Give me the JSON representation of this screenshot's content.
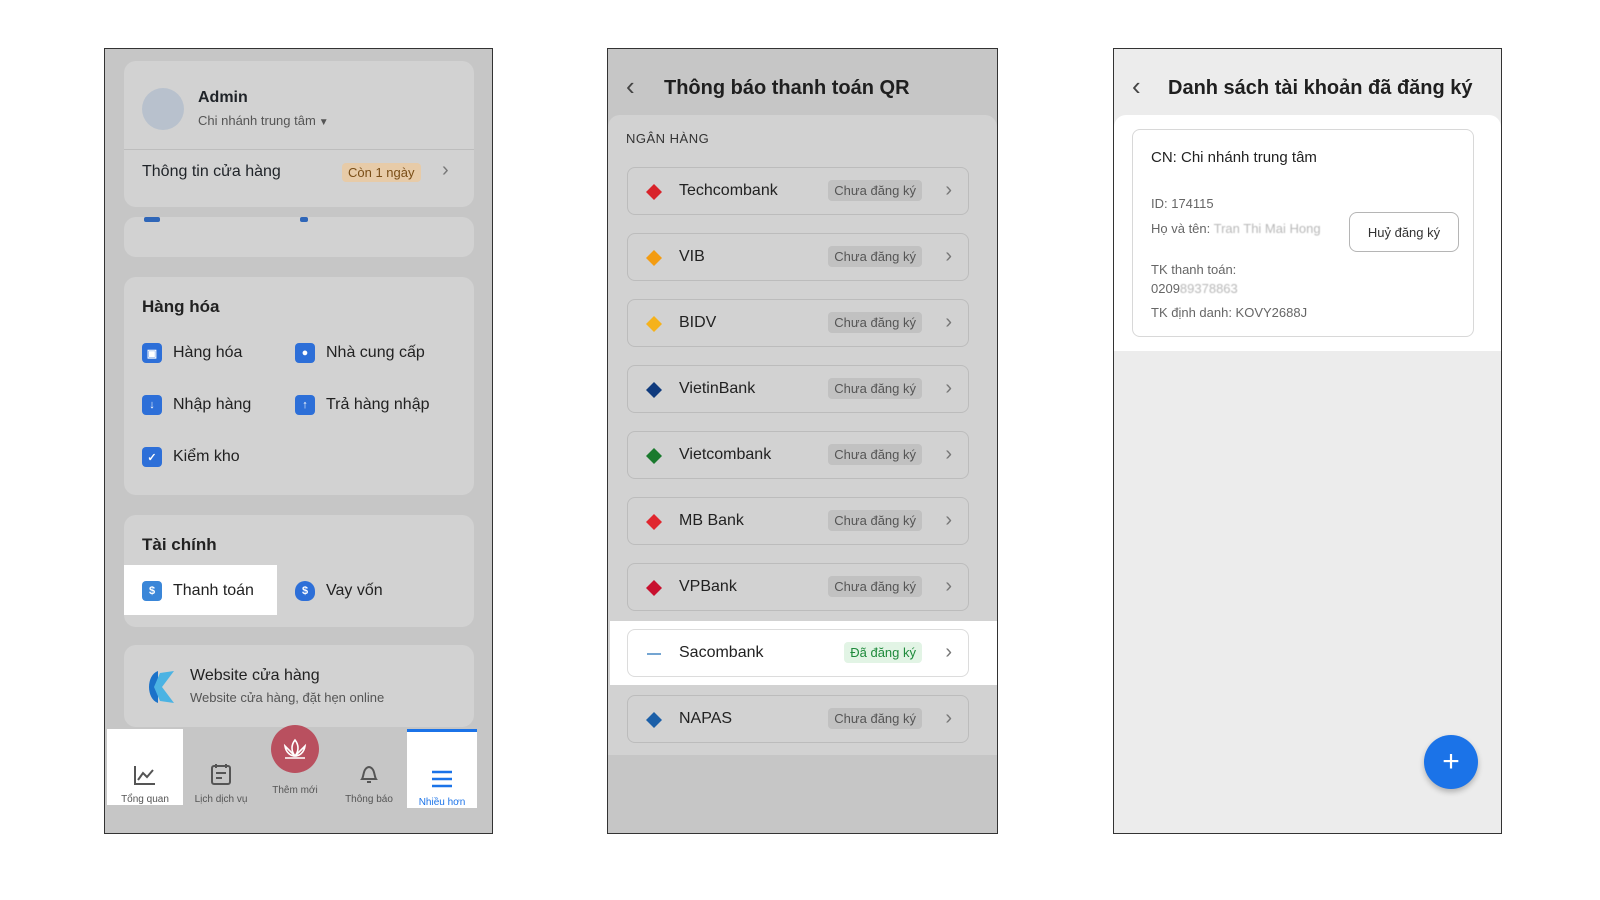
{
  "panel1": {
    "profile": {
      "name": "Admin",
      "branch": "Chi nhánh trung tâm",
      "store_info": "Thông tin cửa hàng",
      "days_badge": "Còn 1 ngày"
    },
    "goods": {
      "title": "Hàng hóa",
      "items": [
        {
          "label": "Hàng hóa",
          "icon": "box-icon"
        },
        {
          "label": "Nhà cung cấp",
          "icon": "supplier-icon"
        },
        {
          "label": "Nhập hàng",
          "icon": "import-icon"
        },
        {
          "label": "Trả hàng nhập",
          "icon": "return-icon"
        },
        {
          "label": "Kiểm kho",
          "icon": "stock-check-icon"
        }
      ]
    },
    "finance": {
      "title": "Tài chính",
      "items": [
        {
          "label": "Thanh toán",
          "icon": "payment-icon"
        },
        {
          "label": "Vay vốn",
          "icon": "loan-icon"
        }
      ]
    },
    "website": {
      "title": "Website cửa hàng",
      "subtitle": "Website cửa hàng, đặt hẹn online"
    },
    "nav": {
      "overview": "Tổng quan",
      "schedule": "Lịch dịch vụ",
      "add_new": "Thêm mới",
      "notifications": "Thông báo",
      "more": "Nhiều hơn"
    }
  },
  "panel2": {
    "title": "Thông báo thanh toán QR",
    "section_label": "NGÂN HÀNG",
    "banks": [
      {
        "name": "Techcombank",
        "status": "Chưa đăng ký",
        "color": "#d8232a"
      },
      {
        "name": "VIB",
        "status": "Chưa đăng ký",
        "color": "#f39c12"
      },
      {
        "name": "BIDV",
        "status": "Chưa đăng ký",
        "color": "#f5b21b"
      },
      {
        "name": "VietinBank",
        "status": "Chưa đăng ký",
        "color": "#0f3a7d"
      },
      {
        "name": "Vietcombank",
        "status": "Chưa đăng ký",
        "color": "#1a7a2e"
      },
      {
        "name": "MB Bank",
        "status": "Chưa đăng ký",
        "color": "#e0262e"
      },
      {
        "name": "VPBank",
        "status": "Chưa đăng ký",
        "color": "#c8102e"
      },
      {
        "name": "Sacombank",
        "status": "Đã đăng ký",
        "color": "#1769b3"
      },
      {
        "name": "NAPAS",
        "status": "Chưa đăng ký",
        "color": "#1b5fa8"
      }
    ]
  },
  "panel3": {
    "title": "Danh sách tài khoản đã đăng ký",
    "account": {
      "branch": "CN: Chi nhánh trung tâm",
      "id_label": "ID: 174115",
      "name_label": "Họ và tên: ",
      "name_value": "Tran Thi Mai Hong",
      "account_label": "TK thanh toán:",
      "account_prefix": "0209",
      "account_blurred": "89378863",
      "identifier": "TK định danh: KOVY2688J",
      "cancel_button": "Huỷ đăng ký"
    },
    "fab": "+"
  }
}
